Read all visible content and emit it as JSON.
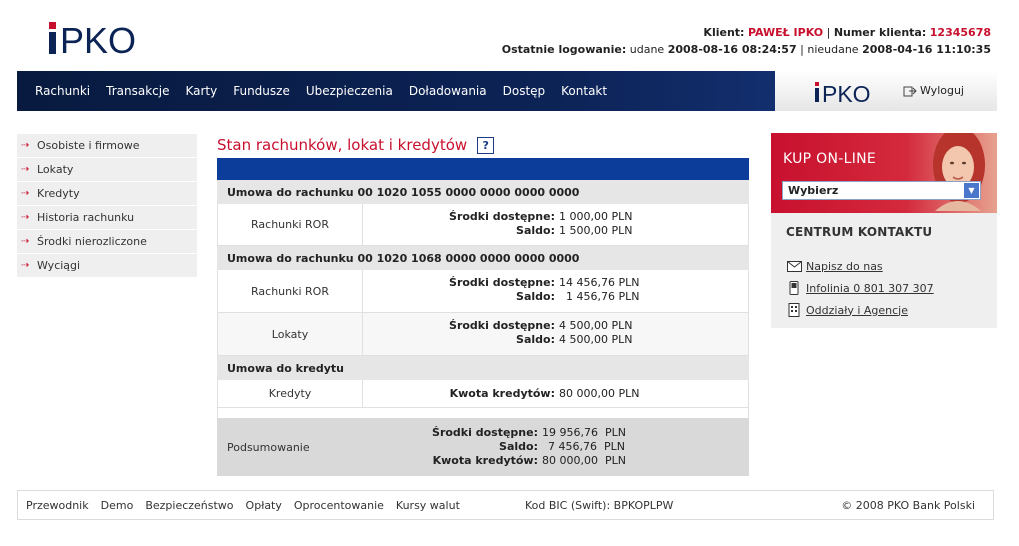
{
  "brand": {
    "logo_text": "PKO"
  },
  "header": {
    "client_label": "Klient:",
    "client_name": "PAWEŁ IPKO",
    "sep1": "|",
    "client_number_label": "Numer klienta:",
    "client_number": "12345678",
    "last_login_label": "Ostatnie logowanie:",
    "ok_label": "udane",
    "ok_date": "2008-08-16 08:24:57",
    "sep2": "|",
    "fail_label": "nieudane",
    "fail_date": "2008-04-16 11:10:35"
  },
  "nav": {
    "items": [
      "Rachunki",
      "Transakcje",
      "Karty",
      "Fundusze",
      "Ubezpieczenia",
      "Doładowania",
      "Dostęp",
      "Kontakt"
    ],
    "logout": "Wyloguj"
  },
  "sidebar": {
    "items": [
      "Osobiste i firmowe",
      "Lokaty",
      "Kredyty",
      "Historia rachunku",
      "Środki nierozliczone",
      "Wyciągi"
    ]
  },
  "main": {
    "title": "Stan rachunków, lokat i kredytów",
    "help": "?",
    "sections": [
      {
        "header": "Umowa do rachunku 00 1020 1055 0000 0000 0000 0000",
        "rows": [
          {
            "label": "Rachunki ROR",
            "pairs": [
              {
                "k": "Środki dostępne:",
                "v": "1 000,00 PLN"
              },
              {
                "k": "Saldo:",
                "v": "1 500,00 PLN"
              }
            ]
          }
        ]
      },
      {
        "header": "Umowa do rachunku 00 1020 1068 0000 0000 0000 0000",
        "rows": [
          {
            "label": "Rachunki ROR",
            "pairs": [
              {
                "k": "Środki dostępne:",
                "v": "14 456,76 PLN"
              },
              {
                "k": "Saldo:",
                "v": "  1 456,76 PLN"
              }
            ]
          },
          {
            "label": "Lokaty",
            "pairs": [
              {
                "k": "Środki dostępne:",
                "v": "4 500,00 PLN"
              },
              {
                "k": "Saldo:",
                "v": "4 500,00 PLN"
              }
            ]
          }
        ]
      },
      {
        "header": "Umowa do kredytu",
        "rows": [
          {
            "label": "Kredyty",
            "pairs": [
              {
                "k": "Kwota kredytów:",
                "v": "80 000,00 PLN"
              }
            ]
          }
        ]
      }
    ],
    "summary": {
      "label": "Podsumowanie",
      "pairs": [
        {
          "k": "Środki dostępne:",
          "v": "19 956,76  PLN"
        },
        {
          "k": "Saldo:",
          "v": "7 456,76  PLN"
        },
        {
          "k": "Kwota kredytów:",
          "v": "80 000,00  PLN"
        }
      ]
    }
  },
  "promo": {
    "title": "KUP ON-LINE",
    "select_value": "Wybierz"
  },
  "contact": {
    "title": "CENTRUM KONTAKTU",
    "items": [
      {
        "icon": "envelope-icon",
        "label": "Napisz do nas"
      },
      {
        "icon": "phone-icon",
        "label": "Infolinia 0 801 307 307"
      },
      {
        "icon": "building-icon",
        "label": "Oddziały i Agencje"
      }
    ]
  },
  "footer": {
    "links": [
      "Przewodnik",
      "Demo",
      "Bezpieczeństwo",
      "Opłaty",
      "Oprocentowanie",
      "Kursy walut"
    ],
    "bic": "Kod BIC (Swift): BPKOPLPW",
    "copyright": "© 2008 PKO Bank Polski"
  },
  "colors": {
    "accent_red": "#c8102e",
    "nav_blue": "#0c2356",
    "table_blue": "#0c3d9b"
  }
}
